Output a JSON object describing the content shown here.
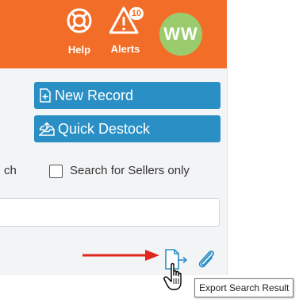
{
  "colors": {
    "header": "#f26d27",
    "button": "#2a8fc4",
    "avatar": "#9acc6e",
    "arrow": "#e0271f"
  },
  "header": {
    "help_label": "Help",
    "help_icon": "lifebuoy-icon",
    "alerts_label": "Alerts",
    "alerts_icon": "warning-triangle-icon",
    "alerts_count": "10",
    "avatar_initials": "WW"
  },
  "actions": {
    "new_record_label": "New Record",
    "new_record_icon": "new-file-icon",
    "quick_destock_label": "Quick Destock",
    "quick_destock_icon": "inbox-upload-icon"
  },
  "search": {
    "cut_label": "ch",
    "sellers_only_label": "Search for Sellers only",
    "sellers_only_checked": false,
    "input_value": ""
  },
  "toolbar": {
    "export_icon": "file-export-icon",
    "attach_icon": "paperclip-icon",
    "tooltip": "Export Search Result"
  }
}
